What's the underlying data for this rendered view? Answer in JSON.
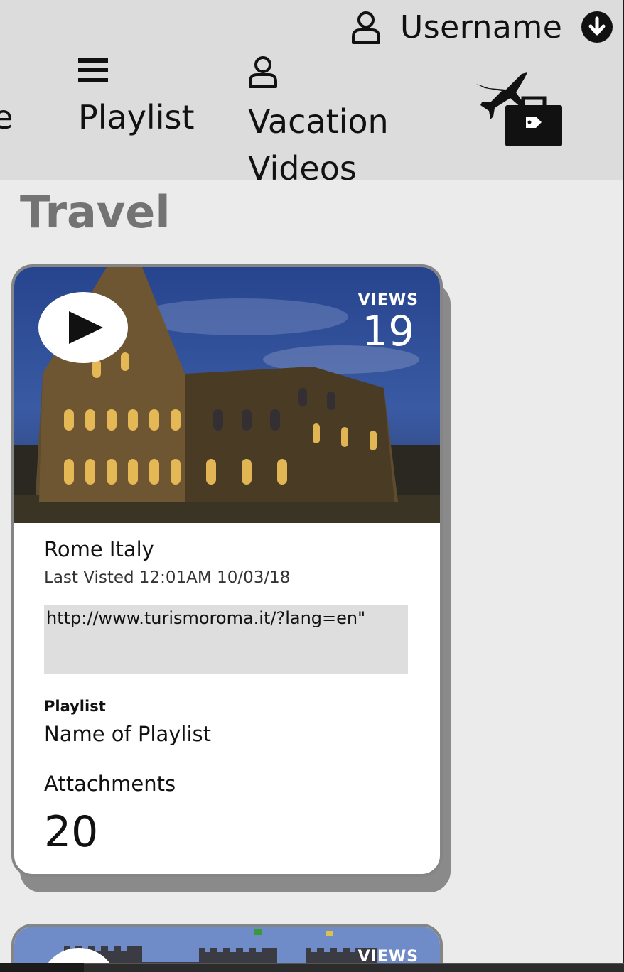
{
  "header": {
    "username": "Username",
    "nav_partial": "e",
    "nav": [
      {
        "label": "Playlist",
        "icon": "hamburger-icon"
      },
      {
        "label": "Vacation Videos",
        "icon": "user-icon"
      }
    ],
    "travel_icon": "plane-luggage-icon"
  },
  "section": {
    "title": "Travel"
  },
  "cards": [
    {
      "views_label": "VIEWS",
      "views_count": "19",
      "place": "Rome Italy",
      "last_visited": "Last Visted 12:01AM 10/03/18",
      "url": "http://www.turismoroma.it/?lang=en\"",
      "playlist_label": "Playlist",
      "playlist_name": "Name of Playlist",
      "attachments_label": "Attachments",
      "attachments_count": "20"
    },
    {
      "views_label": "VIEWS"
    }
  ],
  "colors": {
    "header_bg": "#dcdcdc",
    "page_bg": "#ebebeb",
    "title": "#737373",
    "url_bg": "#dedede"
  }
}
